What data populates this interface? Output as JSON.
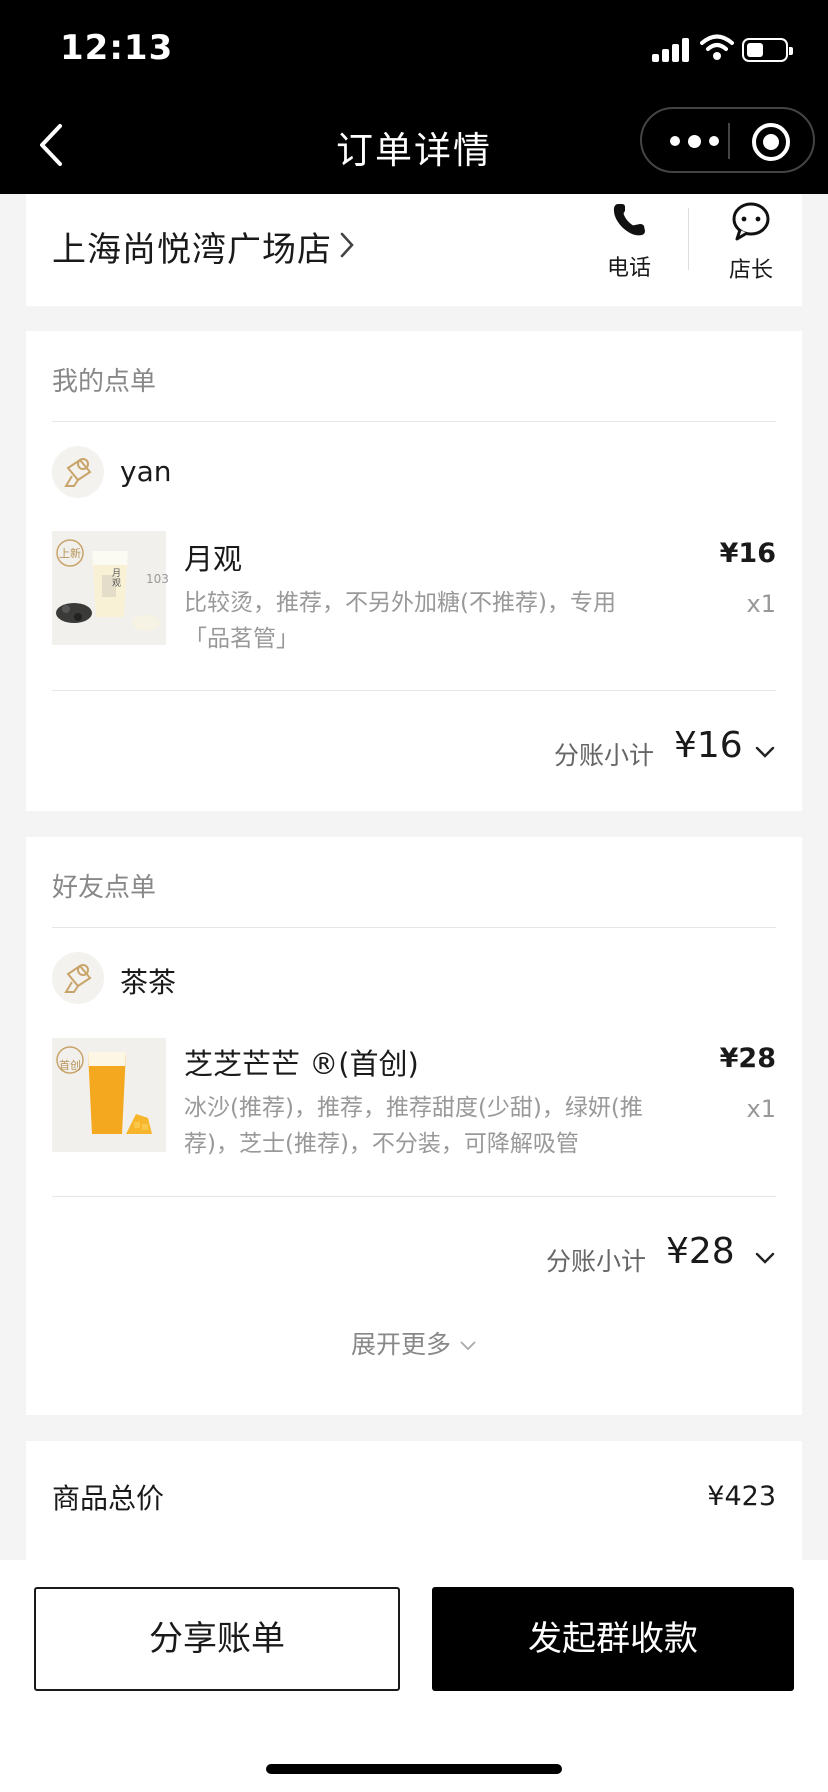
{
  "status_bar": {
    "time": "12:13"
  },
  "nav": {
    "title": "订单详情"
  },
  "store": {
    "name": "上海尚悦湾广场店",
    "phone_label": "电话",
    "manager_label": "店长"
  },
  "my_order": {
    "section_title": "我的点单",
    "user_name": "yan",
    "item": {
      "name": "月观",
      "desc": "比较烫，推荐，不另外加糖(不推荐)，专用「品茗管」",
      "price": "¥16",
      "qty": "x1",
      "thumb_tag": "上新",
      "thumb_cal": "103",
      "thumb_brand": "月观"
    },
    "subtotal_label": "分账小计",
    "subtotal": "¥16"
  },
  "friend_order": {
    "section_title": "好友点单",
    "user_name": "茶茶",
    "item": {
      "name": "芝芝芒芒 ®(首创)",
      "desc": "冰沙(推荐)，推荐，推荐甜度(少甜)，绿妍(推荐)，芝士(推荐)，不分装，可降解吸管",
      "price": "¥28",
      "qty": "x1",
      "thumb_tag": "首创"
    },
    "subtotal_label": "分账小计",
    "subtotal": "¥28",
    "expand_label": "展开更多"
  },
  "total": {
    "label": "商品总价",
    "value": "¥423"
  },
  "actions": {
    "share_label": "分享账单",
    "collect_label": "发起群收款"
  },
  "colors": {
    "nav_bg": "#000000",
    "primary_button": "#000000",
    "mango": "#f2a020"
  }
}
